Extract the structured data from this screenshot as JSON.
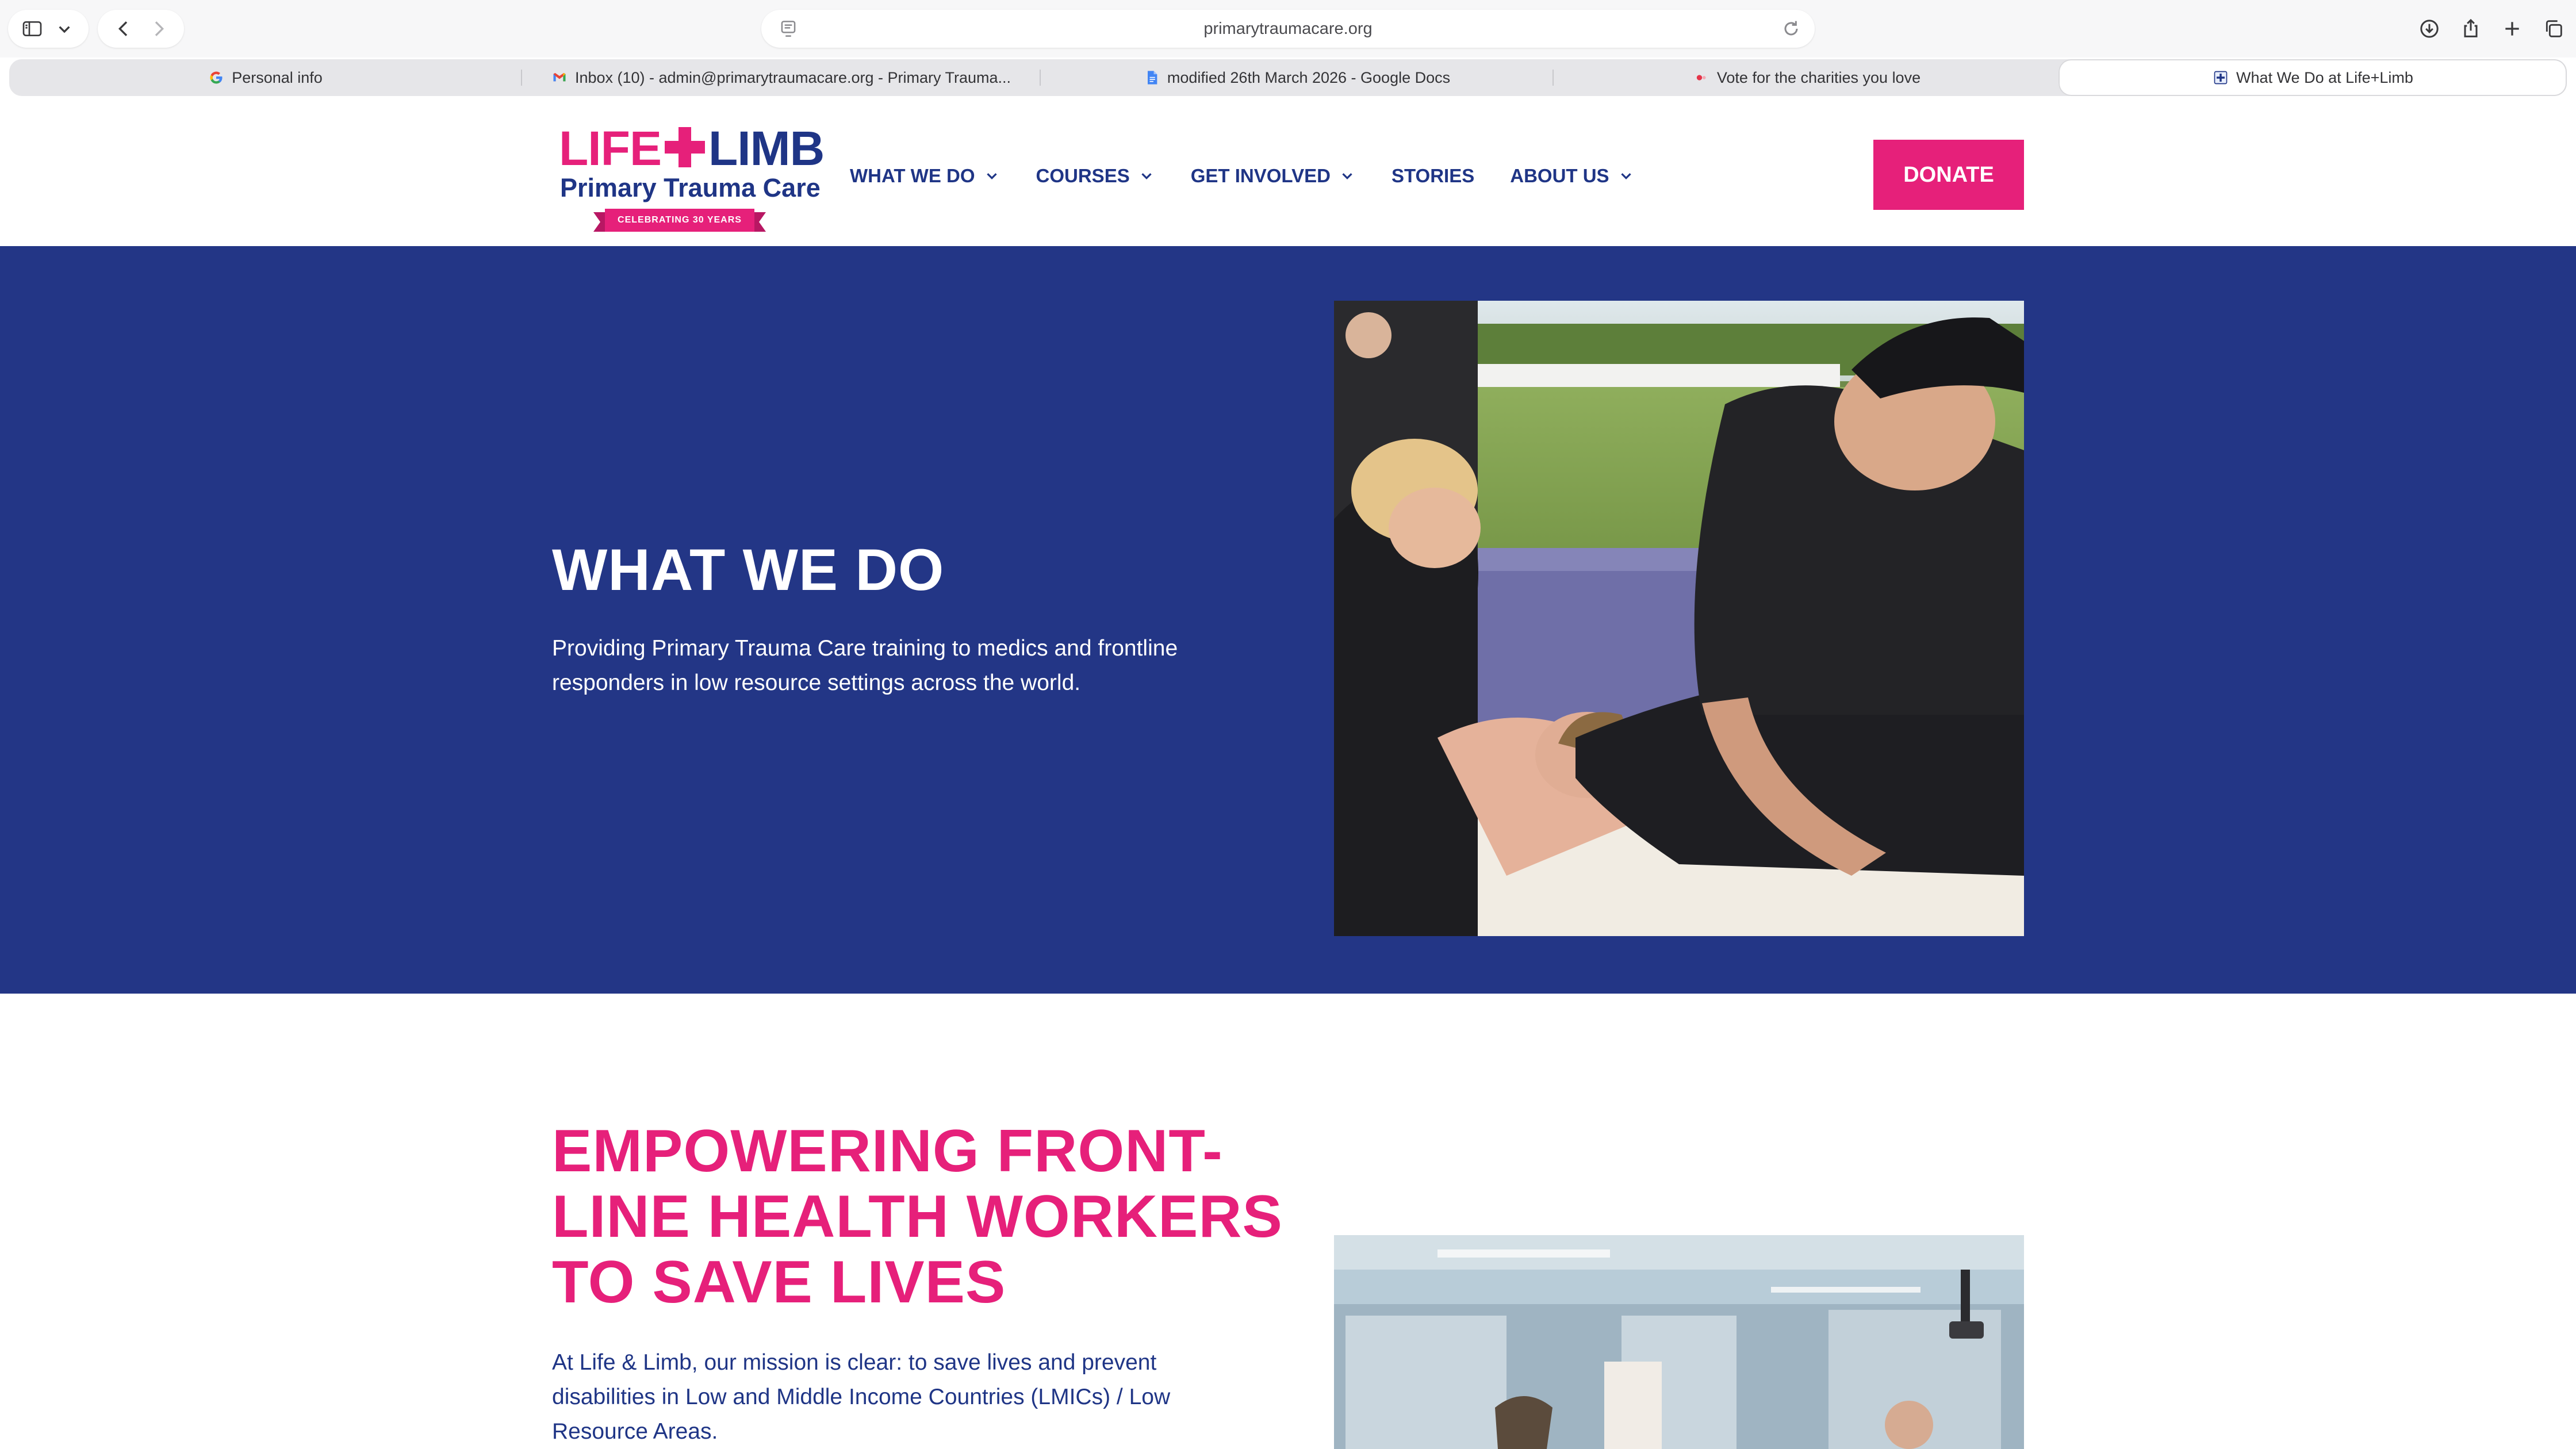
{
  "browser": {
    "url": "primarytraumacare.org",
    "tabs": [
      {
        "title": "Personal info",
        "icon": "google-icon",
        "active": false
      },
      {
        "title": "Inbox (10) - admin@primarytraumacare.org - Primary Trauma...",
        "icon": "gmail-icon",
        "active": false
      },
      {
        "title": "modified 26th March 2026 - Google Docs",
        "icon": "google-docs-icon",
        "active": false
      },
      {
        "title": "Vote for the charities you love",
        "icon": "charity-icon",
        "active": false
      },
      {
        "title": "What We Do at Life+Limb",
        "icon": "life-limb-icon",
        "active": true
      }
    ]
  },
  "site": {
    "logo": {
      "life": "LIFE",
      "limb": "LIMB",
      "subtitle": "Primary Trauma Care",
      "ribbon": "CELEBRATING 30 YEARS"
    },
    "nav": [
      {
        "label": "WHAT WE DO",
        "has_dropdown": true
      },
      {
        "label": "COURSES",
        "has_dropdown": true
      },
      {
        "label": "GET INVOLVED",
        "has_dropdown": true
      },
      {
        "label": "STORIES",
        "has_dropdown": false
      },
      {
        "label": "ABOUT US",
        "has_dropdown": true
      }
    ],
    "donate_label": "DONATE"
  },
  "hero": {
    "title": "WHAT WE DO",
    "text": "Providing Primary Trauma Care training to medics and frontline responders in low resource settings across the world."
  },
  "mission": {
    "title": "EMPOWERING FRONT-LINE HEALTH WORKERS TO SAVE LIVES",
    "text": "At Life & Limb, our mission is clear: to save lives and prevent disabilities in Low and Middle Income Countries (LMICs) / Low Resource Areas."
  },
  "colors": {
    "brand_pink": "#e6207a",
    "brand_navy": "#1f3586",
    "hero_bg": "#233686"
  }
}
